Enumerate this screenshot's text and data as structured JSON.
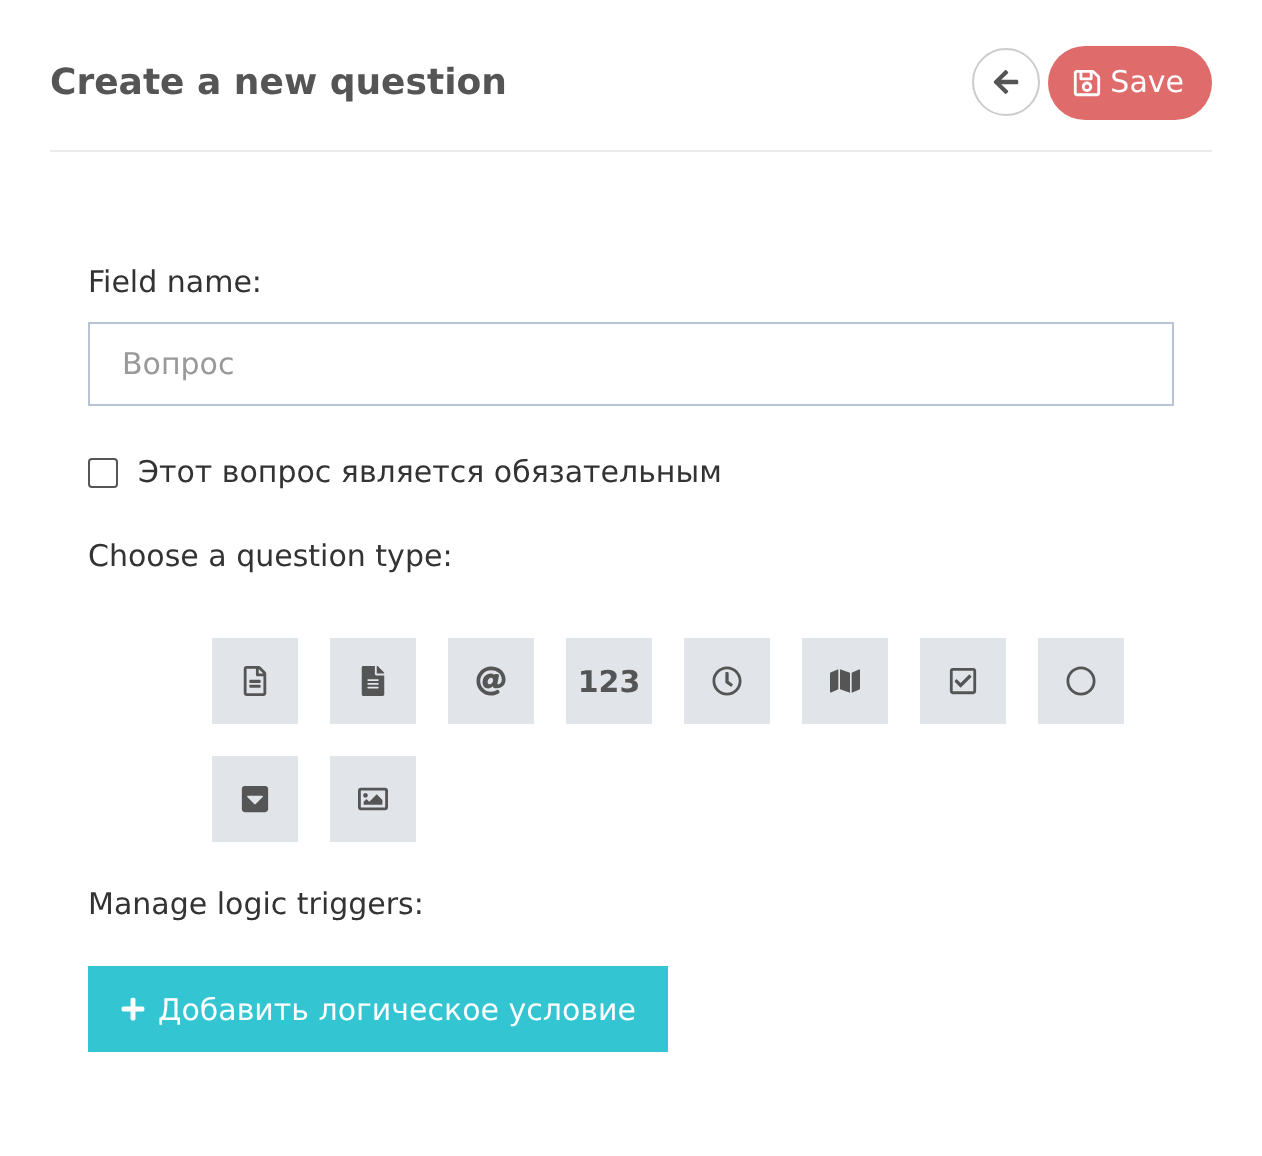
{
  "header": {
    "title": "Create a new question",
    "save_button": "Save"
  },
  "form": {
    "field_label": "Field name:",
    "field": {
      "placeholder": "Вопрос"
    },
    "required": {
      "label": "Этот вопрос является обязательным",
      "checked": false
    },
    "type_label": "Choose a question type:",
    "question_types": [
      {
        "kind": "text"
      },
      {
        "kind": "paragraph"
      },
      {
        "kind": "email"
      },
      {
        "kind": "number",
        "label": "123"
      },
      {
        "kind": "time"
      },
      {
        "kind": "map"
      },
      {
        "kind": "checkbox"
      },
      {
        "kind": "radio"
      },
      {
        "kind": "dropdown"
      },
      {
        "kind": "image"
      }
    ],
    "logic_label": "Manage logic triggers:",
    "add_logic_button": "Добавить логическое условие"
  }
}
